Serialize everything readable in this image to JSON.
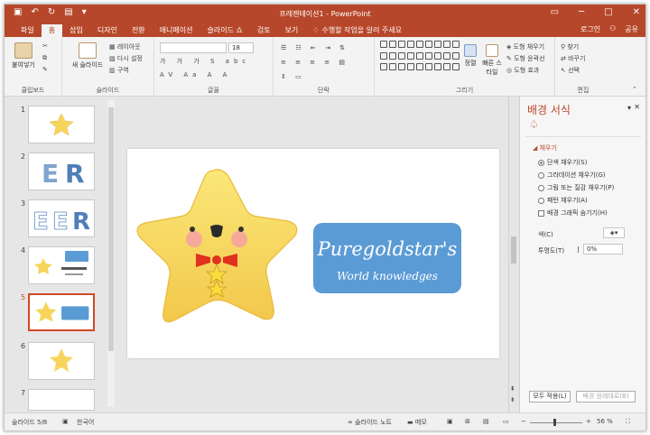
{
  "window": {
    "title": "프레젠테이션1 - PowerPoint"
  },
  "tabs": [
    {
      "label": "파일"
    },
    {
      "label": "홈"
    },
    {
      "label": "삽입"
    },
    {
      "label": "디자인"
    },
    {
      "label": "전환"
    },
    {
      "label": "애니메이션"
    },
    {
      "label": "슬라이드 쇼"
    },
    {
      "label": "검토"
    },
    {
      "label": "보기"
    }
  ],
  "tell_me": "수행할 작업을 알려 주세요",
  "account": {
    "login": "로그인",
    "share": "공유"
  },
  "ribbon": {
    "clipboard": {
      "paste": "붙여넣기",
      "label": "클립보드"
    },
    "slides": {
      "new_slide": "새 슬라이드",
      "layout": "레이아웃",
      "reset": "다시 설정",
      "section": "구역",
      "label": "슬라이드"
    },
    "font": {
      "size": "18",
      "label": "글꼴"
    },
    "paragraph": {
      "label": "단락"
    },
    "drawing": {
      "arrange": "정렬",
      "quick_styles": "빠른 스타일",
      "fill": "도형 채우기",
      "outline": "도형 윤곽선",
      "effects": "도형 효과",
      "label": "그리기"
    },
    "editing": {
      "find": "찾기",
      "replace": "바꾸기",
      "select": "선택",
      "label": "편집"
    }
  },
  "thumbnails": [
    {
      "num": "1"
    },
    {
      "num": "2"
    },
    {
      "num": "3"
    },
    {
      "num": "4"
    },
    {
      "num": "5"
    },
    {
      "num": "6"
    },
    {
      "num": "7"
    }
  ],
  "slide": {
    "title_text": "Puregoldstar's",
    "subtitle_text": "World knowledges",
    "banner_color": "#5b9bd5",
    "star_color": "#f7d55c"
  },
  "format_pane": {
    "title": "배경 서식",
    "section": "채우기",
    "options": [
      {
        "label": "단색 채우기(S)",
        "checked": true
      },
      {
        "label": "그라데이션 채우기(G)",
        "checked": false
      },
      {
        "label": "그림 또는 질감 채우기(P)",
        "checked": false
      },
      {
        "label": "패턴 채우기(A)",
        "checked": false
      }
    ],
    "hide_graphics": "배경 그래픽 숨기기(H)",
    "color_label": "색(C)",
    "transparency_label": "투명도(T)",
    "transparency_value": "0%",
    "apply_all": "모두 적용(L)",
    "reset_bg": "배경 원래대로(B)"
  },
  "status": {
    "slide_pos": "슬라이드 5/8",
    "language": "한국어",
    "notes": "슬라이드 노트",
    "comments": "메모",
    "zoom": "56 %"
  }
}
